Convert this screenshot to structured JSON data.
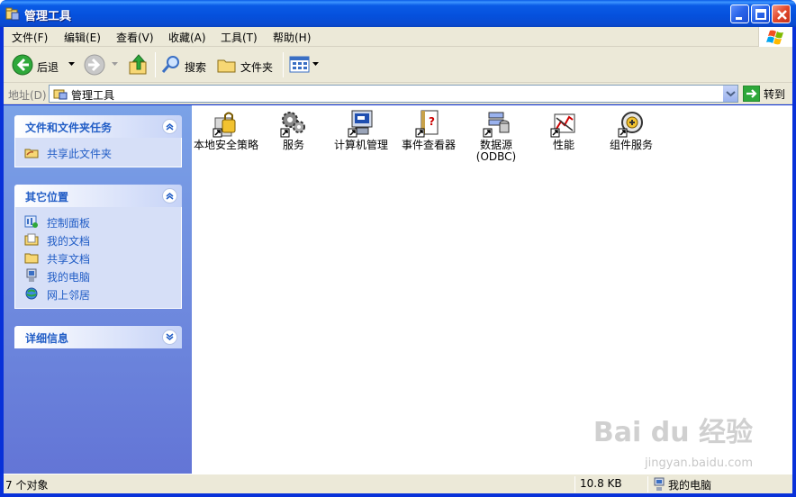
{
  "window": {
    "title": "管理工具"
  },
  "menubar": {
    "items": [
      "文件(F)",
      "编辑(E)",
      "查看(V)",
      "收藏(A)",
      "工具(T)",
      "帮助(H)"
    ]
  },
  "toolbar": {
    "back_label": "后退",
    "search_label": "搜索",
    "folders_label": "文件夹"
  },
  "address": {
    "label": "地址(D)",
    "value": "管理工具",
    "go_label": "转到"
  },
  "sidebar": {
    "panels": [
      {
        "title": "文件和文件夹任务",
        "items": [
          {
            "label": "共享此文件夹",
            "icon": "share-folder-icon"
          }
        ]
      },
      {
        "title": "其它位置",
        "items": [
          {
            "label": "控制面板",
            "icon": "control-panel-icon"
          },
          {
            "label": "我的文档",
            "icon": "my-documents-icon"
          },
          {
            "label": "共享文档",
            "icon": "shared-documents-icon"
          },
          {
            "label": "我的电脑",
            "icon": "my-computer-icon"
          },
          {
            "label": "网上邻居",
            "icon": "network-icon"
          }
        ]
      },
      {
        "title": "详细信息",
        "items": []
      }
    ]
  },
  "content": {
    "items": [
      {
        "label": "本地安全策略",
        "icon": "security-policy-icon"
      },
      {
        "label": "服务",
        "icon": "services-icon"
      },
      {
        "label": "计算机管理",
        "icon": "computer-management-icon"
      },
      {
        "label": "事件查看器",
        "icon": "event-viewer-icon"
      },
      {
        "label": "数据源 (ODBC)",
        "icon": "odbc-icon"
      },
      {
        "label": "性能",
        "icon": "performance-icon"
      },
      {
        "label": "组件服务",
        "icon": "component-services-icon"
      }
    ]
  },
  "statusbar": {
    "objects": "7 个对象",
    "size": "10.8 KB",
    "zone": "我的电脑"
  },
  "watermark": {
    "text": "Bai du 经验",
    "url": "jingyan.baidu.com"
  }
}
